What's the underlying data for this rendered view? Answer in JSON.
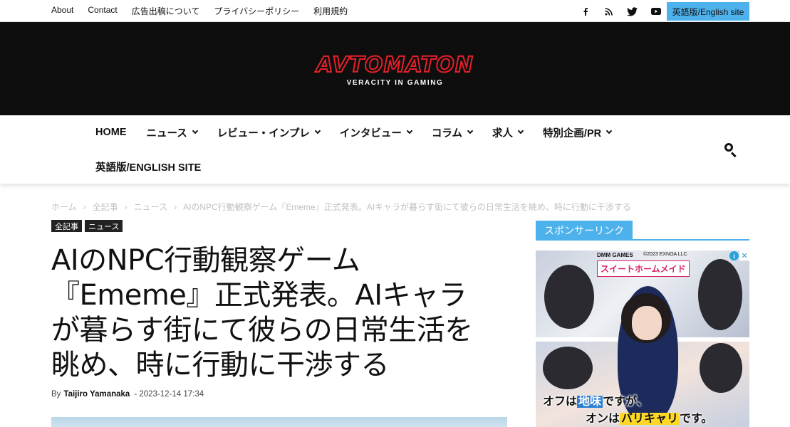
{
  "topbar": {
    "menu": [
      "About",
      "Contact",
      "広告出稿について",
      "プライバシーポリシー",
      "利用規約"
    ],
    "social_icons": [
      "facebook-icon",
      "rss-icon",
      "twitter-icon",
      "youtube-icon"
    ],
    "english_button": "英語版/English site",
    "accent_color": "#4db2ec"
  },
  "header": {
    "logo_text": "AVTOMATON",
    "tagline": "VERACITY IN GAMING",
    "logo_color": "#e4202a"
  },
  "nav": {
    "row1": [
      {
        "label": "HOME",
        "has_dropdown": false
      },
      {
        "label": "ニュース",
        "has_dropdown": true
      },
      {
        "label": "レビュー・インプレ",
        "has_dropdown": true
      },
      {
        "label": "インタビュー",
        "has_dropdown": true
      },
      {
        "label": "コラム",
        "has_dropdown": true
      },
      {
        "label": "求人",
        "has_dropdown": true
      },
      {
        "label": "特別企画/PR",
        "has_dropdown": true
      }
    ],
    "row2": [
      {
        "label": "英語版/ENGLISH SITE",
        "has_dropdown": false
      }
    ],
    "search_icon": "search-icon"
  },
  "breadcrumb": [
    "ホーム",
    "全記事",
    "ニュース",
    "AIのNPC行動観察ゲーム『Ememe』正式発表。AIキャラが暮らす街にて彼らの日常生活を眺め、時に行動に干渉する"
  ],
  "article": {
    "categories": [
      "全記事",
      "ニュース"
    ],
    "title_lines": [
      "AIのNPC行動観察ゲーム",
      "『Ememe』正式発表。AIキャラ",
      "が暮らす街にて彼らの日常生活を",
      "眺め、時に行動に干渉する"
    ],
    "by_label": "By",
    "author": "Taijiro Yamanaka",
    "date": "- 2023-12-14 17:34"
  },
  "sidebar": {
    "heading": "スポンサーリンク",
    "ad": {
      "brand": "DMM GAMES",
      "copyright": "©2023 EXNOA LLC",
      "game_title": "スイートホームメイド",
      "line1_pre": "オフは",
      "line1_hl": "地味",
      "line1_post": "ですが、",
      "line2_pre": "オンは",
      "line2_hl": "バリキャリ",
      "line2_post": "です。",
      "info_label": "i",
      "close_label": "✕"
    }
  }
}
